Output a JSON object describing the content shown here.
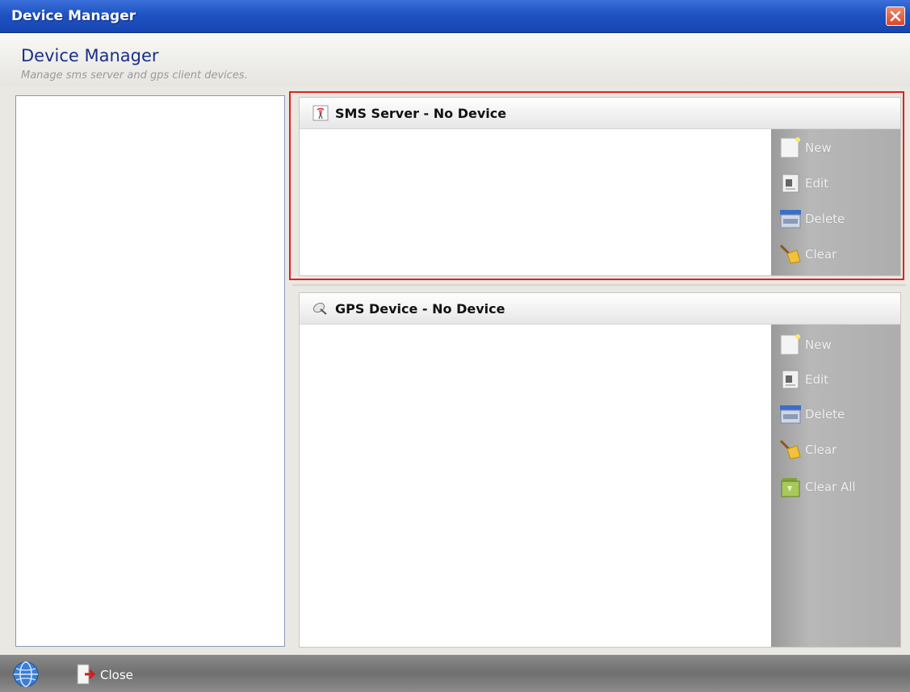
{
  "window": {
    "title": "Device Manager"
  },
  "header": {
    "title": "Device Manager",
    "subtitle": "Manage sms server and gps client devices."
  },
  "sms_panel": {
    "title": "SMS Server - No Device",
    "actions": [
      {
        "label": "New",
        "icon": "new-document-icon"
      },
      {
        "label": "Edit",
        "icon": "edit-icon"
      },
      {
        "label": "Delete",
        "icon": "delete-icon"
      },
      {
        "label": "Clear",
        "icon": "broom-icon"
      }
    ]
  },
  "gps_panel": {
    "title": "GPS Device - No Device",
    "actions": [
      {
        "label": "New",
        "icon": "new-document-icon"
      },
      {
        "label": "Edit",
        "icon": "edit-icon"
      },
      {
        "label": "Delete",
        "icon": "delete-icon"
      },
      {
        "label": "Clear",
        "icon": "broom-icon"
      },
      {
        "label": "Clear All",
        "icon": "recycle-bin-icon"
      }
    ]
  },
  "footer": {
    "close_label": "Close"
  },
  "colors": {
    "highlight": "#e02020",
    "titlebar": "#1f53c2",
    "header_title": "#1b2f86"
  }
}
